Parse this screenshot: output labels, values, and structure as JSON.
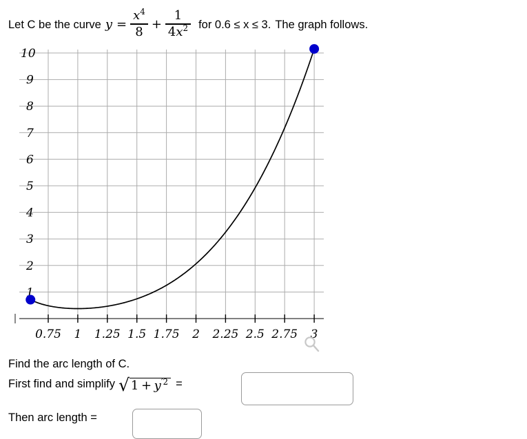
{
  "statement": {
    "lead": "Let C be the curve",
    "y_var": "y",
    "equals": "=",
    "term1_num": "x",
    "term1_num_exp": "4",
    "term1_den": "8",
    "plus": "+",
    "term2_num": "1",
    "term2_den_coeff": "4",
    "term2_den_var": "x",
    "term2_den_exp": "2",
    "domain_text": "for 0.6 ≤ x ≤ 3.",
    "tail": "The graph follows."
  },
  "questions": {
    "find_arc_length": "Find the arc length of C.",
    "first_find_prefix": "First find and simplify",
    "radical_body_one": "1",
    "radical_body_plus": "+",
    "radical_body_y": "y",
    "radical_body_prime_exp": "′2",
    "equals": "=",
    "then_arc_length": "Then arc length =",
    "answer_derivative_value": "",
    "answer_derivative_placeholder": "",
    "answer_arclength_value": "",
    "answer_arclength_placeholder": ""
  },
  "icons": {
    "magnifier": "zoom-icon"
  },
  "colors": {
    "point": "#0000CC",
    "curve": "#000000",
    "grid": "#ACACAC",
    "axis": "#6E6E6E",
    "input_border": "#9A9A9A",
    "magnifier": "#C8C8C8"
  },
  "chart_data": {
    "type": "line",
    "title": "",
    "xlabel": "",
    "ylabel": "",
    "function": "y = x^4/8 + 1/(4x^2)",
    "xlim": [
      0.6,
      3.1
    ],
    "ylim": [
      0,
      10.7
    ],
    "grid": true,
    "legend": null,
    "x_ticks": [
      "0.75",
      "1",
      "1.25",
      "1.5",
      "1.75",
      "2",
      "2.25",
      "2.5",
      "2.75",
      "3"
    ],
    "x_tick_values": [
      0.75,
      1,
      1.25,
      1.5,
      1.75,
      2,
      2.25,
      2.5,
      2.75,
      3
    ],
    "y_ticks": [
      "1",
      "2",
      "3",
      "4",
      "5",
      "6",
      "7",
      "8",
      "9",
      "10"
    ],
    "y_tick_values": [
      1,
      2,
      3,
      4,
      5,
      6,
      7,
      8,
      9,
      10
    ],
    "x": [
      0.6,
      0.7,
      0.8,
      0.9,
      1.0,
      1.1,
      1.2,
      1.3,
      1.4,
      1.5,
      1.6,
      1.7,
      1.8,
      1.9,
      2.0,
      2.1,
      2.2,
      2.3,
      2.4,
      2.5,
      2.6,
      2.7,
      2.8,
      2.9,
      3.0
    ],
    "y": [
      0.711,
      0.54,
      0.441,
      0.39,
      0.375,
      0.39,
      0.432,
      0.504,
      0.608,
      0.744,
      0.917,
      1.131,
      1.39,
      1.697,
      2.063,
      2.49,
      2.98,
      3.545,
      4.19,
      4.92,
      5.745,
      6.669,
      7.718,
      8.854,
      10.153
    ],
    "endpoints": [
      {
        "x": 0.6,
        "y": 0.711,
        "style": "filled-dot",
        "color": "#0000CC"
      },
      {
        "x": 3.0,
        "y": 10.153,
        "style": "filled-dot",
        "color": "#0000CC"
      }
    ]
  }
}
